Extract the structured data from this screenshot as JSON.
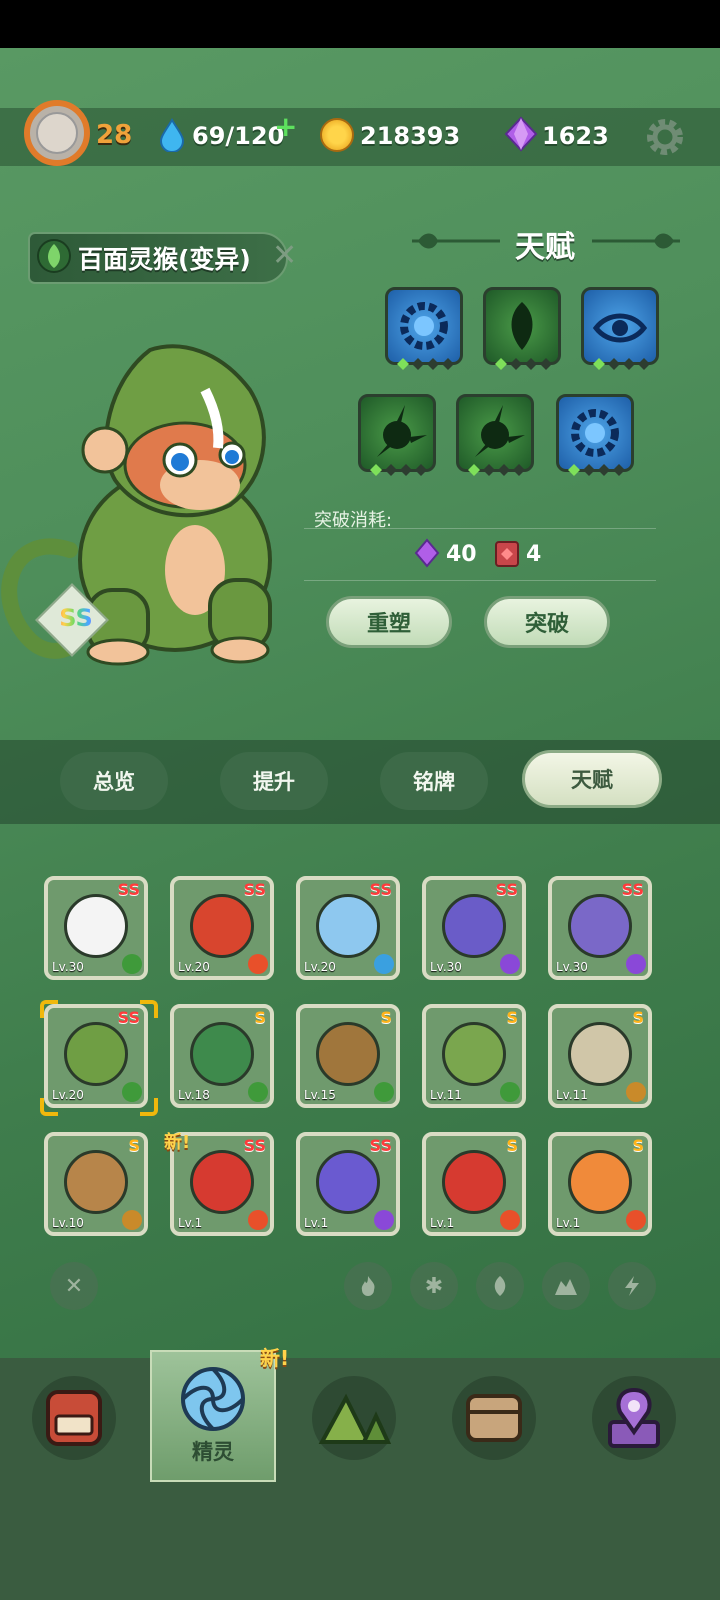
{
  "status": {
    "level": "28",
    "water": "69/120",
    "coins": "218393",
    "gems": "1623"
  },
  "pet": {
    "name": "百面灵猴(变异)",
    "grade": "SS"
  },
  "talent": {
    "title": "天赋",
    "cost_label": "突破消耗:",
    "cost_gem": "40",
    "cost_book": "4",
    "reshape_label": "重塑",
    "breakthrough_label": "突破"
  },
  "tabs": [
    {
      "label": "总览"
    },
    {
      "label": "提升"
    },
    {
      "label": "铭牌"
    },
    {
      "label": "天赋"
    }
  ],
  "pets": [
    {
      "grade": "SS",
      "level": "Lv.30",
      "element": "leaf"
    },
    {
      "grade": "SS",
      "level": "Lv.20",
      "element": "fire"
    },
    {
      "grade": "SS",
      "level": "Lv.20",
      "element": "ice"
    },
    {
      "grade": "SS",
      "level": "Lv.30",
      "element": "lightning"
    },
    {
      "grade": "SS",
      "level": "Lv.30",
      "element": "lightning"
    },
    {
      "grade": "SS",
      "level": "Lv.20",
      "element": "leaf"
    },
    {
      "grade": "S",
      "level": "Lv.18",
      "element": "leaf"
    },
    {
      "grade": "S",
      "level": "Lv.15",
      "element": "leaf"
    },
    {
      "grade": "S",
      "level": "Lv.11",
      "element": "leaf"
    },
    {
      "grade": "S",
      "level": "Lv.11",
      "element": "earth"
    },
    {
      "grade": "S",
      "level": "Lv.10",
      "element": "earth"
    },
    {
      "grade": "SS",
      "level": "Lv.1",
      "element": "fire"
    },
    {
      "grade": "SS",
      "level": "Lv.1",
      "element": "lightning"
    },
    {
      "grade": "S",
      "level": "Lv.1",
      "element": "fire"
    },
    {
      "grade": "S",
      "level": "Lv.1",
      "element": "fire"
    }
  ],
  "new_badge": "新!",
  "nav": {
    "active_label": "精灵",
    "new_badge": "新!"
  },
  "colors": {
    "fire": "#e8502a",
    "leaf": "#3f9a3a",
    "ice": "#3aa0e0",
    "lightning": "#8a48d8",
    "earth": "#c98a2a"
  }
}
